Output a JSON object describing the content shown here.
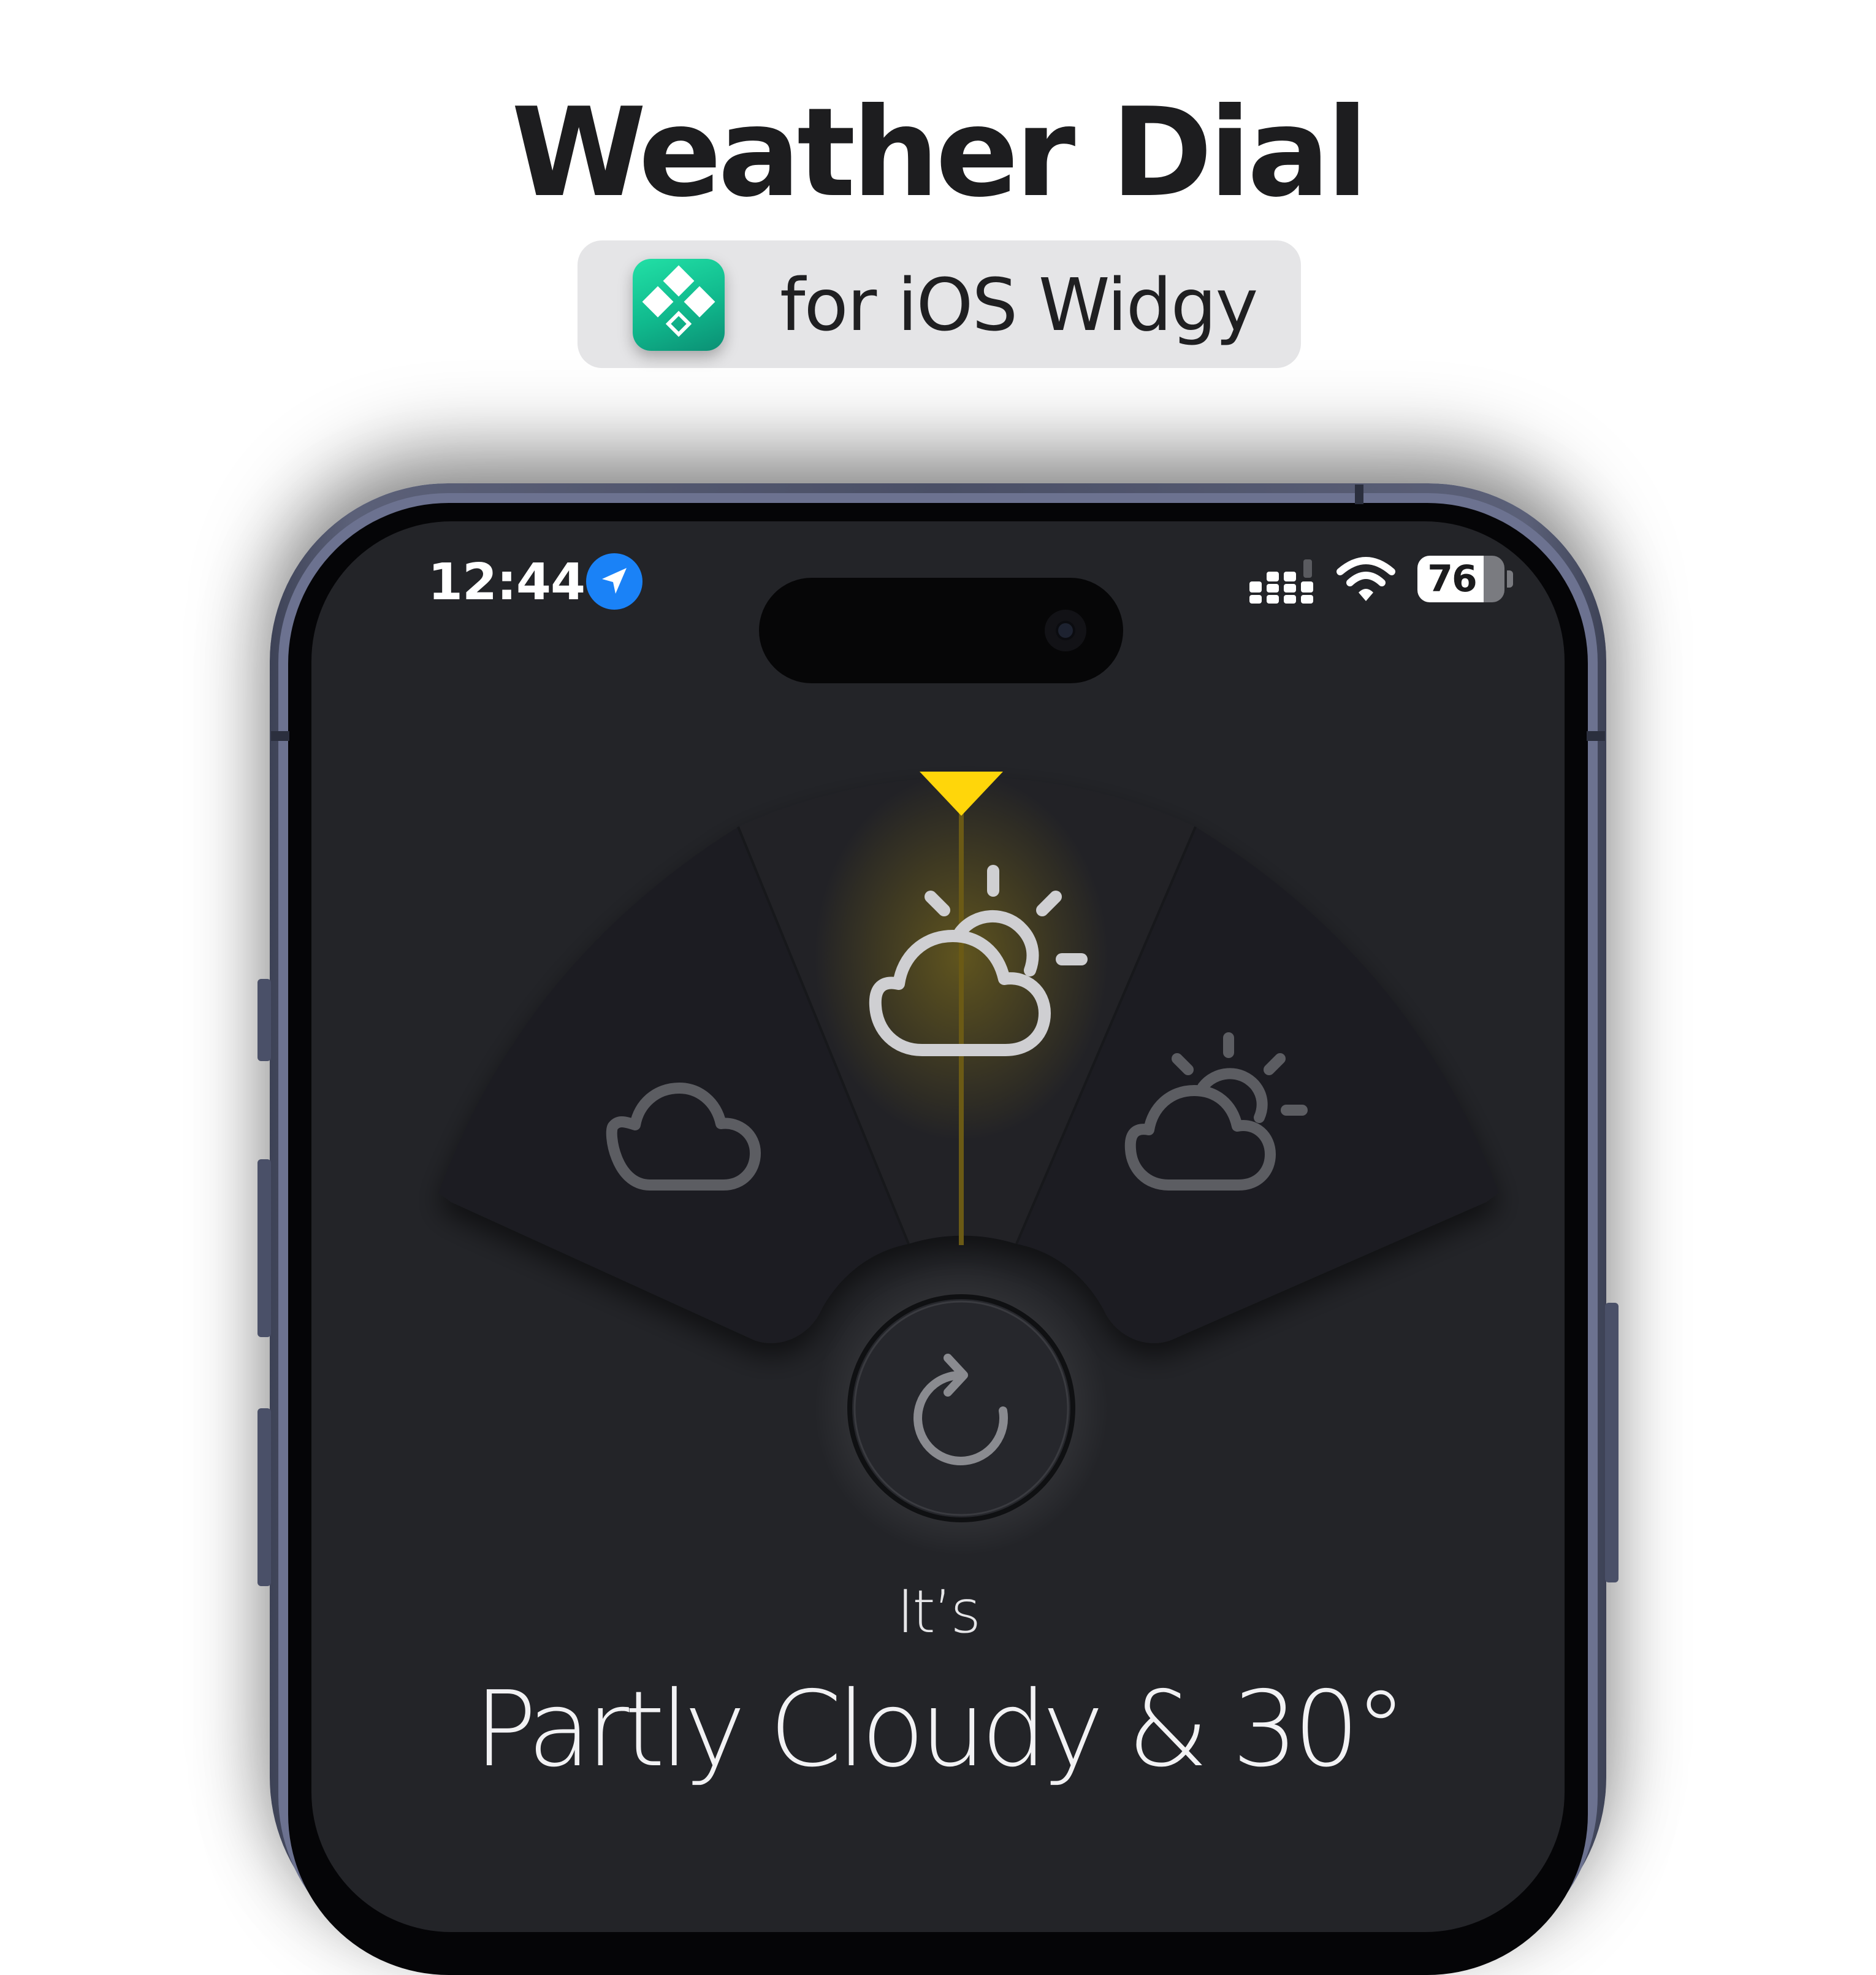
{
  "header": {
    "title": "Weather Dial",
    "subtitle": "for iOS Widgy",
    "app_icon": "widgy-app-icon"
  },
  "status_bar": {
    "time": "12:44",
    "location_icon": "location-arrow-icon",
    "signal_icon": "cellular-signal-icon",
    "wifi_icon": "wifi-icon",
    "battery_level": 76,
    "battery_text": "76"
  },
  "dial": {
    "segments": [
      {
        "icon": "cloud-icon",
        "state": "inactive"
      },
      {
        "icon": "partly-cloudy-icon",
        "state": "selected"
      },
      {
        "icon": "partly-cloudy-icon",
        "state": "inactive"
      }
    ],
    "pointer_color": "#ffd60a",
    "refresh_icon": "refresh-icon"
  },
  "weather": {
    "prefix": "It’s",
    "summary": "Partly Cloudy & 30°"
  },
  "colors": {
    "screen_bg": "#232428",
    "frame": "#4a4f66",
    "accent": "#ffd60a",
    "app_icon": "#10b98d"
  }
}
